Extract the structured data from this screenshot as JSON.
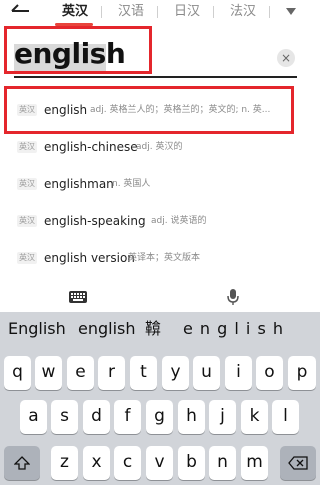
{
  "tabs": [
    {
      "label": "英汉",
      "active": true
    },
    {
      "label": "汉语",
      "active": false
    },
    {
      "label": "日汉",
      "active": false
    },
    {
      "label": "法汉",
      "active": false
    }
  ],
  "search": {
    "value": "english",
    "clear_glyph": "×"
  },
  "results": [
    {
      "badge": "英汉",
      "word": "english",
      "definition": "adj. 英格兰人的；英格兰的；英文的; n. 英..."
    },
    {
      "badge": "英汉",
      "word": "english-chinese",
      "definition": "adj. 英汉的"
    },
    {
      "badge": "英汉",
      "word": "englishman",
      "definition": "n. 英国人"
    },
    {
      "badge": "英汉",
      "word": "english-speaking",
      "definition": "adj. 说英语的"
    },
    {
      "badge": "英汉",
      "word": "english version",
      "definition": "英译本；英文版本"
    }
  ],
  "keyboard": {
    "candidates": [
      "English",
      "english",
      "鞥",
      "e n g l i s h"
    ],
    "row1": [
      "q",
      "w",
      "e",
      "r",
      "t",
      "y",
      "u",
      "i",
      "o",
      "p"
    ],
    "row2": [
      "a",
      "s",
      "d",
      "f",
      "g",
      "h",
      "j",
      "k",
      "l"
    ],
    "row3": [
      "z",
      "x",
      "c",
      "v",
      "b",
      "n",
      "m"
    ]
  },
  "icons": {
    "back": "back-arrow-icon",
    "more": "chevron-down-icon",
    "keyboard": "keyboard-icon",
    "mic": "microphone-icon",
    "shift": "shift-icon",
    "delete": "backspace-icon"
  },
  "colors": {
    "highlight_box": "#e4262c",
    "tab_underline": "#e8453c",
    "keyboard_bg": "#d1d4d9"
  }
}
